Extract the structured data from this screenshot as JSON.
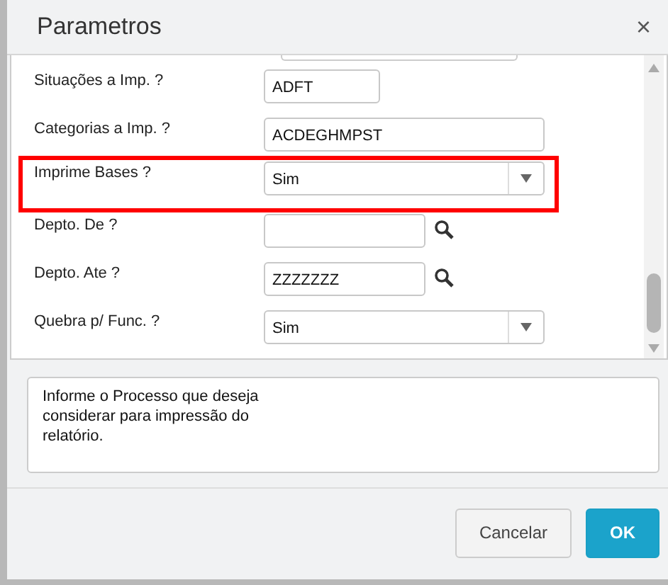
{
  "window": {
    "title": "Parametros",
    "close": "×"
  },
  "fields": [
    {
      "label": "Situações a Imp. ?",
      "kind": "text",
      "value": "ADFT",
      "highlighted": false
    },
    {
      "label": "Categorias a Imp. ?",
      "kind": "text",
      "value": "ACDEGHMPST",
      "highlighted": false
    },
    {
      "label": "Imprime Bases ?",
      "kind": "select",
      "value": "Sim",
      "highlighted": true
    },
    {
      "label": "Depto. De ?",
      "kind": "lookup",
      "highlighted": false
    },
    {
      "label": "Depto. Ate ?",
      "kind": "lookup",
      "value": "ZZZZZZZ",
      "highlighted": false
    },
    {
      "label": "Quebra p/ Func. ?",
      "kind": "select",
      "value": "Sim",
      "highlighted": false
    }
  ],
  "help": "Informe o Processo que deseja considerar para impressão do relatório.",
  "buttons": [
    {
      "label": "Cancelar",
      "kind": "secondary"
    },
    {
      "label": "OK",
      "kind": "primary"
    }
  ]
}
